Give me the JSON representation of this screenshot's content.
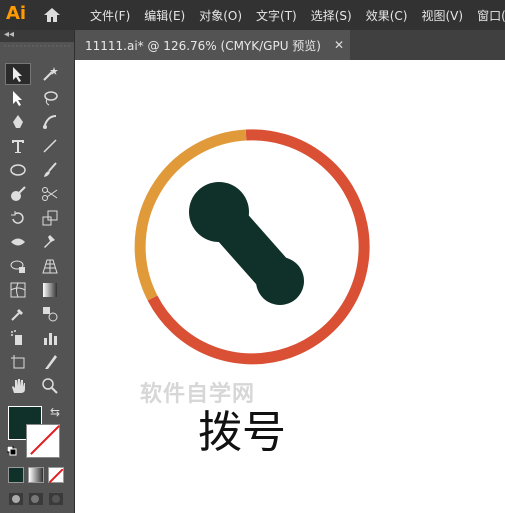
{
  "app": {
    "logo": "Ai"
  },
  "menu": {
    "items": [
      "文件(F)",
      "编辑(E)",
      "对象(O)",
      "文字(T)",
      "选择(S)",
      "效果(C)",
      "视图(V)",
      "窗口("
    ]
  },
  "document_tab": {
    "title": "11111.ai* @ 126.76% (CMYK/GPU 预览)",
    "close": "✕"
  },
  "toolbar": {
    "collapse_label": "◂◂"
  },
  "colors": {
    "fill": "#10302a",
    "ring_orange": "#e09a3a",
    "ring_red": "#d95035",
    "phone": "#10302a"
  },
  "canvas": {
    "watermark": "软件自学网",
    "caption": "拨号"
  }
}
